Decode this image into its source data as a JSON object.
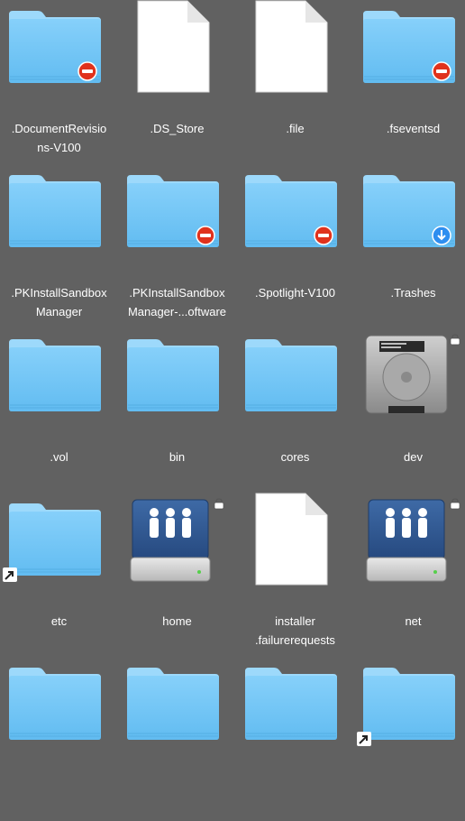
{
  "window": {
    "view": "icon-grid"
  },
  "rows": [
    [
      {
        "type": "folder",
        "badge": "no-entry",
        "lines": [
          ".DocumentRevisio",
          "ns-V100"
        ]
      },
      {
        "type": "document",
        "lines": [
          ".DS_Store"
        ]
      },
      {
        "type": "document",
        "lines": [
          ".file"
        ]
      },
      {
        "type": "folder",
        "badge": "no-entry",
        "lines": [
          ".fseventsd"
        ]
      }
    ],
    [
      {
        "type": "folder",
        "lines": [
          ".PKInstallSandbox",
          "Manager"
        ]
      },
      {
        "type": "folder",
        "badge": "no-entry",
        "lines": [
          ".PKInstallSandbox",
          "Manager-...oftware"
        ]
      },
      {
        "type": "folder",
        "badge": "no-entry",
        "lines": [
          ".Spotlight-V100"
        ]
      },
      {
        "type": "folder",
        "badge": "download",
        "lines": [
          ".Trashes"
        ]
      }
    ],
    [
      {
        "type": "folder",
        "lines": [
          ".vol"
        ]
      },
      {
        "type": "folder",
        "lines": [
          "bin"
        ]
      },
      {
        "type": "folder",
        "lines": [
          "cores"
        ]
      },
      {
        "type": "disk",
        "lock": true,
        "lines": [
          "dev"
        ]
      }
    ],
    [
      {
        "type": "folder",
        "alias": true,
        "lines": [
          "etc"
        ]
      },
      {
        "type": "network-drive",
        "lock": true,
        "lines": [
          "home"
        ]
      },
      {
        "type": "document",
        "lines": [
          "installer",
          ".failurerequests"
        ]
      },
      {
        "type": "network-drive",
        "lock": true,
        "lines": [
          "net"
        ]
      }
    ],
    [
      {
        "type": "folder",
        "lines": []
      },
      {
        "type": "folder",
        "lines": []
      },
      {
        "type": "folder",
        "lines": []
      },
      {
        "type": "folder",
        "alias": true,
        "lines": []
      }
    ]
  ],
  "colors": {
    "background": "#616161",
    "folder_body": "#6ec3f4",
    "folder_tab": "#8fd3fa",
    "label": "#ffffff",
    "badge_red": "#e0321d",
    "badge_blue": "#2e8ef0"
  }
}
